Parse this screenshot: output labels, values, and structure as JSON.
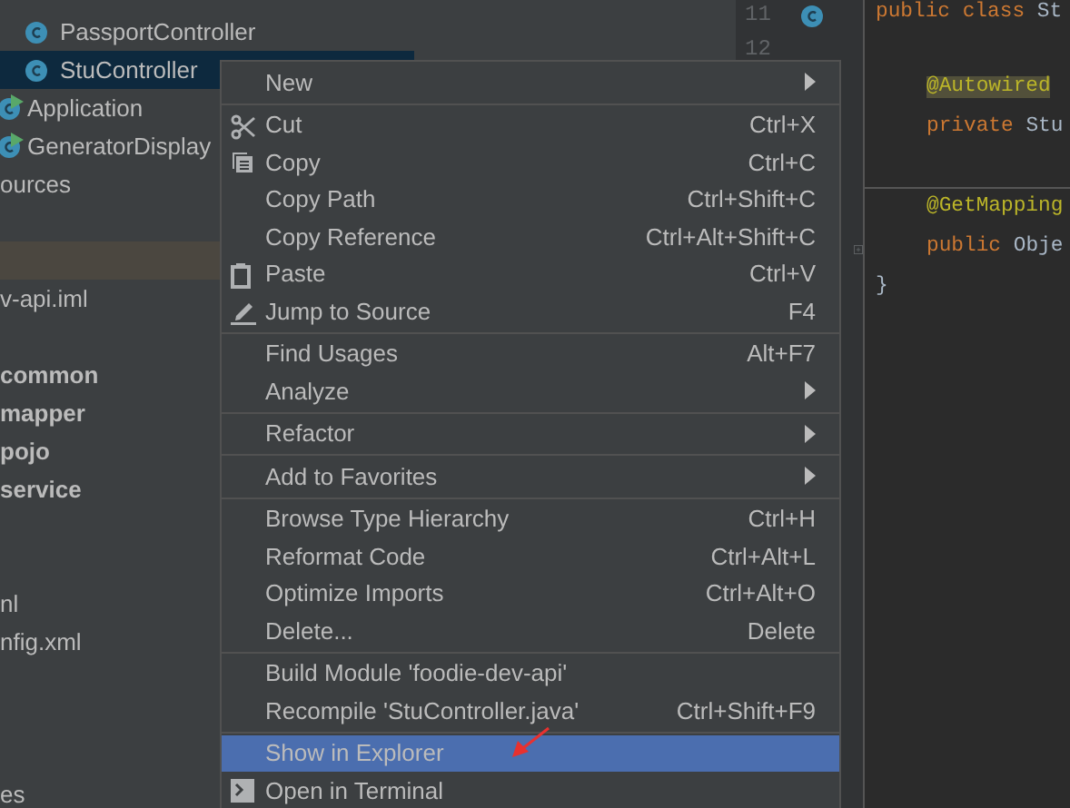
{
  "project_tree": {
    "items": [
      {
        "kind": "class",
        "label": "PassportController",
        "selected": false
      },
      {
        "kind": "class",
        "label": "StuController",
        "selected": true
      },
      {
        "kind": "runnable",
        "label": "Application",
        "selected": false
      },
      {
        "kind": "runnable",
        "label": "GeneratorDisplay",
        "selected": false
      },
      {
        "kind": "text",
        "label": "ources",
        "bold": false
      },
      {
        "kind": "blank",
        "highlighted": false
      },
      {
        "kind": "blank",
        "highlighted": true
      },
      {
        "kind": "text",
        "label": "v-api.iml",
        "bold": false
      },
      {
        "kind": "blank",
        "highlighted": false
      },
      {
        "kind": "text",
        "label": "common",
        "bold": true
      },
      {
        "kind": "text",
        "label": "mapper",
        "bold": true
      },
      {
        "kind": "text",
        "label": "pojo",
        "bold": true
      },
      {
        "kind": "text",
        "label": "service",
        "bold": true
      },
      {
        "kind": "blank",
        "highlighted": false
      },
      {
        "kind": "blank",
        "highlighted": false
      },
      {
        "kind": "text",
        "label": "nl",
        "bold": false
      },
      {
        "kind": "text",
        "label": "nfig.xml",
        "bold": false
      },
      {
        "kind": "blank",
        "highlighted": false
      },
      {
        "kind": "blank",
        "highlighted": false
      },
      {
        "kind": "blank",
        "highlighted": false
      },
      {
        "kind": "text",
        "label": "es",
        "bold": false
      }
    ]
  },
  "editor": {
    "lines": [
      {
        "kind": "declaration",
        "number": "11",
        "tokens": [
          {
            "kind": "keyword",
            "text": "public class "
          },
          {
            "kind": "plain",
            "text": "St"
          }
        ]
      },
      {
        "kind": "plain",
        "number": "12"
      },
      {
        "kind": "plain",
        "tokens": [
          {
            "kind": "annotation",
            "text": "@Autowired",
            "highlighted": true
          }
        ]
      },
      {
        "kind": "plain",
        "tokens": [
          {
            "kind": "keyword",
            "text": "private "
          },
          {
            "kind": "plain",
            "text": "Stu"
          }
        ]
      },
      {
        "kind": "rule"
      },
      {
        "kind": "plain",
        "tokens": [
          {
            "kind": "annotation",
            "text": "@GetMapping",
            "highlighted": false
          }
        ]
      },
      {
        "kind": "method",
        "tokens": [
          {
            "kind": "keyword",
            "text": "public "
          },
          {
            "kind": "plain",
            "text": "Obje"
          }
        ]
      },
      {
        "kind": "close",
        "tokens": [
          {
            "kind": "brace",
            "text": "}"
          }
        ]
      }
    ]
  },
  "context_menu": {
    "items": [
      {
        "kind": "item",
        "label": "New",
        "submenu": true,
        "selected": false
      },
      {
        "kind": "separator"
      },
      {
        "kind": "cut",
        "label": "Cut",
        "shortcut": "Ctrl+X",
        "selected": false
      },
      {
        "kind": "copy",
        "label": "Copy",
        "shortcut": "Ctrl+C",
        "selected": false
      },
      {
        "kind": "item",
        "label": "Copy Path",
        "shortcut": "Ctrl+Shift+C",
        "selected": false
      },
      {
        "kind": "item",
        "label": "Copy Reference",
        "shortcut": "Ctrl+Alt+Shift+C",
        "selected": false
      },
      {
        "kind": "paste",
        "label": "Paste",
        "shortcut": "Ctrl+V",
        "selected": false
      },
      {
        "kind": "edit",
        "label": "Jump to Source",
        "shortcut": "F4",
        "selected": false
      },
      {
        "kind": "separator"
      },
      {
        "kind": "item",
        "label": "Find Usages",
        "shortcut": "Alt+F7",
        "selected": false
      },
      {
        "kind": "item",
        "label": "Analyze",
        "submenu": true,
        "selected": false
      },
      {
        "kind": "separator"
      },
      {
        "kind": "item",
        "label": "Refactor",
        "submenu": true,
        "selected": false
      },
      {
        "kind": "separator"
      },
      {
        "kind": "item",
        "label": "Add to Favorites",
        "submenu": true,
        "selected": false
      },
      {
        "kind": "separator"
      },
      {
        "kind": "item",
        "label": "Browse Type Hierarchy",
        "shortcut": "Ctrl+H",
        "selected": false
      },
      {
        "kind": "item",
        "label": "Reformat Code",
        "shortcut": "Ctrl+Alt+L",
        "selected": false
      },
      {
        "kind": "item",
        "label": "Optimize Imports",
        "shortcut": "Ctrl+Alt+O",
        "selected": false
      },
      {
        "kind": "item",
        "label": "Delete...",
        "shortcut": "Delete",
        "selected": false
      },
      {
        "kind": "separator"
      },
      {
        "kind": "item",
        "label": "Build Module 'foodie-dev-api'",
        "selected": false
      },
      {
        "kind": "item",
        "label": "Recompile 'StuController.java'",
        "shortcut": "Ctrl+Shift+F9",
        "selected": false
      },
      {
        "kind": "separator"
      },
      {
        "kind": "item",
        "label": "Show in Explorer",
        "selected": true
      },
      {
        "kind": "terminal",
        "label": "Open in Terminal",
        "selected": false
      }
    ]
  }
}
